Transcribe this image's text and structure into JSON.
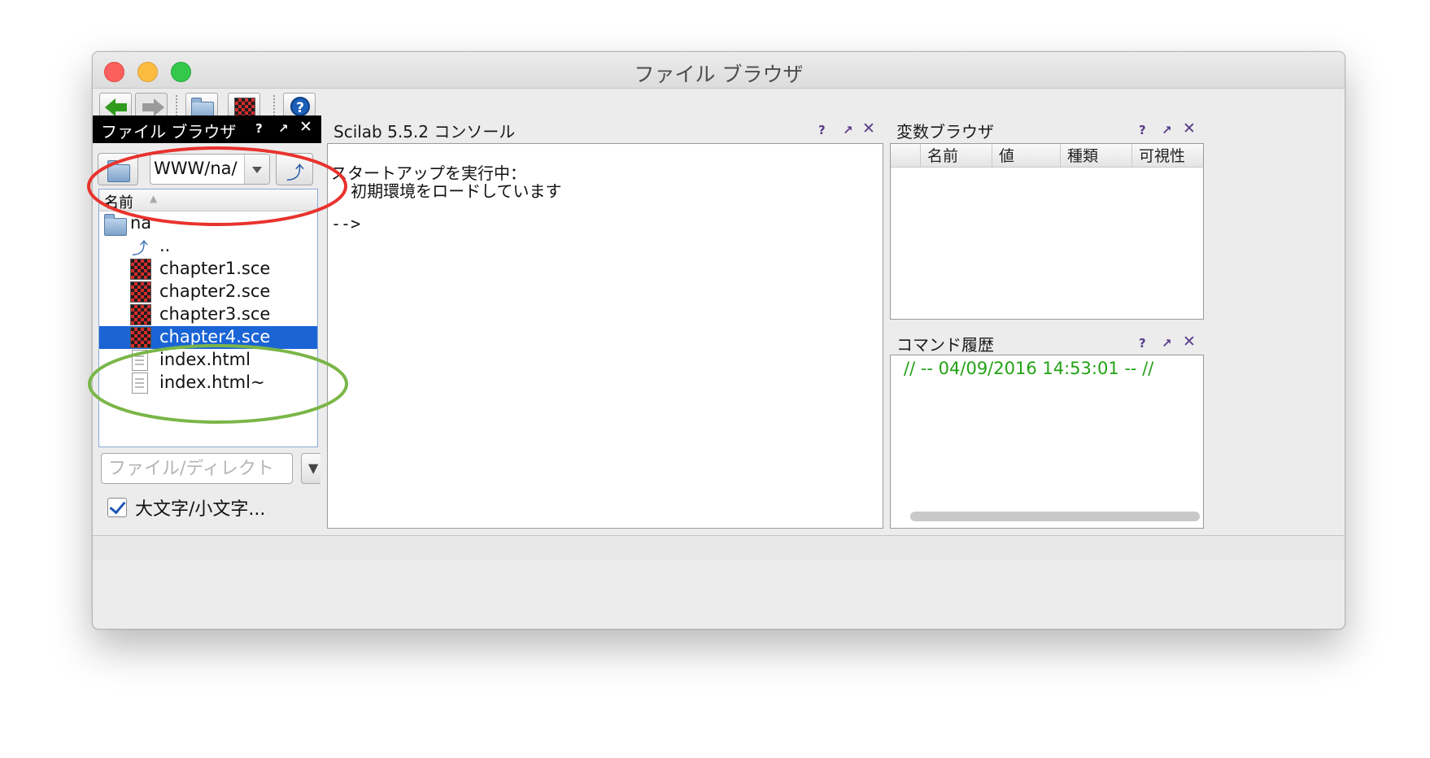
{
  "window": {
    "title": "ファイル ブラウザ"
  },
  "file_browser": {
    "title": "ファイル ブラウザ",
    "path_value": "WWW/na/",
    "column_name": "名前",
    "items": [
      {
        "label": "na",
        "icon": "folder-icon"
      },
      {
        "label": "..",
        "icon": "parent-dir-icon"
      },
      {
        "label": "chapter1.sce",
        "icon": "scilab-file-icon"
      },
      {
        "label": "chapter2.sce",
        "icon": "scilab-file-icon"
      },
      {
        "label": "chapter3.sce",
        "icon": "scilab-file-icon"
      },
      {
        "label": "chapter4.sce",
        "icon": "scilab-file-icon",
        "selected": true
      },
      {
        "label": "index.html",
        "icon": "html-file-icon"
      },
      {
        "label": "index.html~",
        "icon": "text-file-icon"
      }
    ],
    "filter_placeholder": "ファイル/ディレクト",
    "case_checkbox_label": "大文字/小文字...",
    "case_checked": true
  },
  "console": {
    "title": "Scilab 5.5.2 コンソール",
    "lines": [
      "スタートアップを実行中：",
      "  初期環境をロードしています",
      "",
      "-->"
    ]
  },
  "variable_browser": {
    "title": "変数ブラウザ",
    "columns": [
      "名前",
      "値",
      "種類",
      "可視性"
    ]
  },
  "command_history": {
    "title": "コマンド履歴",
    "entry": "// -- 04/09/2016 14:53:01 -- //"
  },
  "panel_controls": {
    "help": "?",
    "undock": "↗",
    "close": "✕"
  },
  "colors": {
    "selection": "#1a64d6",
    "history_text": "#22a214",
    "annotation_red": "#e8332d",
    "annotation_green": "#7ab648"
  }
}
